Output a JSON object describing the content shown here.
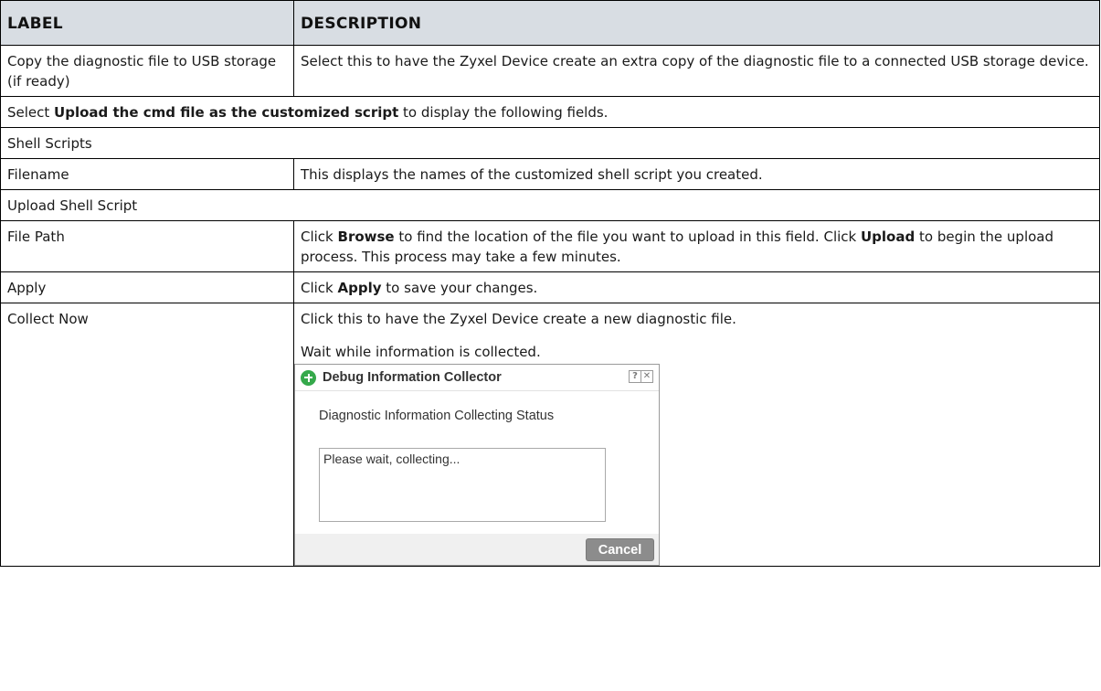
{
  "table": {
    "header": {
      "label": "LABEL",
      "description": "DESCRIPTION"
    },
    "rows": {
      "copy_diag": {
        "label": "Copy the diagnostic file to USB storage (if ready)",
        "description": "Select this to have the Zyxel Device create an extra copy of the diagnostic file to a connected USB storage device."
      },
      "select_upload": {
        "pre": "Select ",
        "bold": "Upload the cmd file as the customized script",
        "post": " to display the following fields."
      },
      "shell_scripts": {
        "label": "Shell Scripts"
      },
      "filename": {
        "label": "Filename",
        "description": "This displays the names of the customized shell script you created."
      },
      "upload_shell_script": {
        "label": "Upload Shell Script"
      },
      "file_path": {
        "label": "File Path",
        "d1": "Click ",
        "b1": "Browse",
        "d2": " to find the location of the file you want to upload in this field. Click ",
        "b2": "Upload",
        "d3": " to begin the upload process. This process may take a few minutes."
      },
      "apply": {
        "label": "Apply",
        "d1": "Click ",
        "b1": "Apply",
        "d2": " to save your changes."
      },
      "collect_now": {
        "label": "Collect Now",
        "line1": "Click this to have the Zyxel Device create a new diagnostic file.",
        "line2": "Wait while information is collected."
      }
    }
  },
  "dialog": {
    "title": "Debug Information Collector",
    "help_glyph": "?",
    "close_glyph": "✕",
    "status_label": "Diagnostic Information Collecting Status",
    "status_text": "Please wait, collecting...",
    "cancel_label": "Cancel",
    "title_icon": "plus-circle-icon",
    "icon_color": "#35a94b"
  }
}
